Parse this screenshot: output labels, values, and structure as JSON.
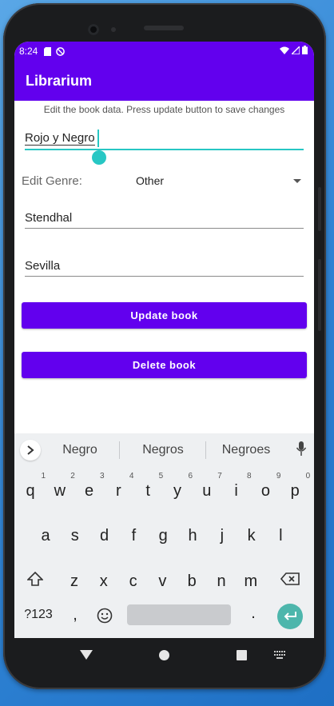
{
  "status": {
    "time": "8:24"
  },
  "app": {
    "title": "Librarium"
  },
  "form": {
    "hint": "Edit the book data. Press update button to save changes",
    "title_value": "Rojo y Negro",
    "genre_label": "Edit Genre:",
    "genre_value": "Other",
    "author_value": "Stendhal",
    "publisher_value": "Sevilla",
    "update_label": "Update book",
    "delete_label": "Delete book"
  },
  "keyboard": {
    "suggestions": [
      "Negro",
      "Negros",
      "Negroes"
    ],
    "row1": [
      {
        "k": "q",
        "n": "1"
      },
      {
        "k": "w",
        "n": "2"
      },
      {
        "k": "e",
        "n": "3"
      },
      {
        "k": "r",
        "n": "4"
      },
      {
        "k": "t",
        "n": "5"
      },
      {
        "k": "y",
        "n": "6"
      },
      {
        "k": "u",
        "n": "7"
      },
      {
        "k": "i",
        "n": "8"
      },
      {
        "k": "o",
        "n": "9"
      },
      {
        "k": "p",
        "n": "0"
      }
    ],
    "row2": [
      "a",
      "s",
      "d",
      "f",
      "g",
      "h",
      "j",
      "k",
      "l"
    ],
    "row3": [
      "z",
      "x",
      "c",
      "v",
      "b",
      "n",
      "m"
    ],
    "symbols_label": "?123",
    "comma": ",",
    "period": "."
  },
  "colors": {
    "accent": "#6200ee",
    "focus": "#27c7c4",
    "enter": "#4db6ac"
  }
}
